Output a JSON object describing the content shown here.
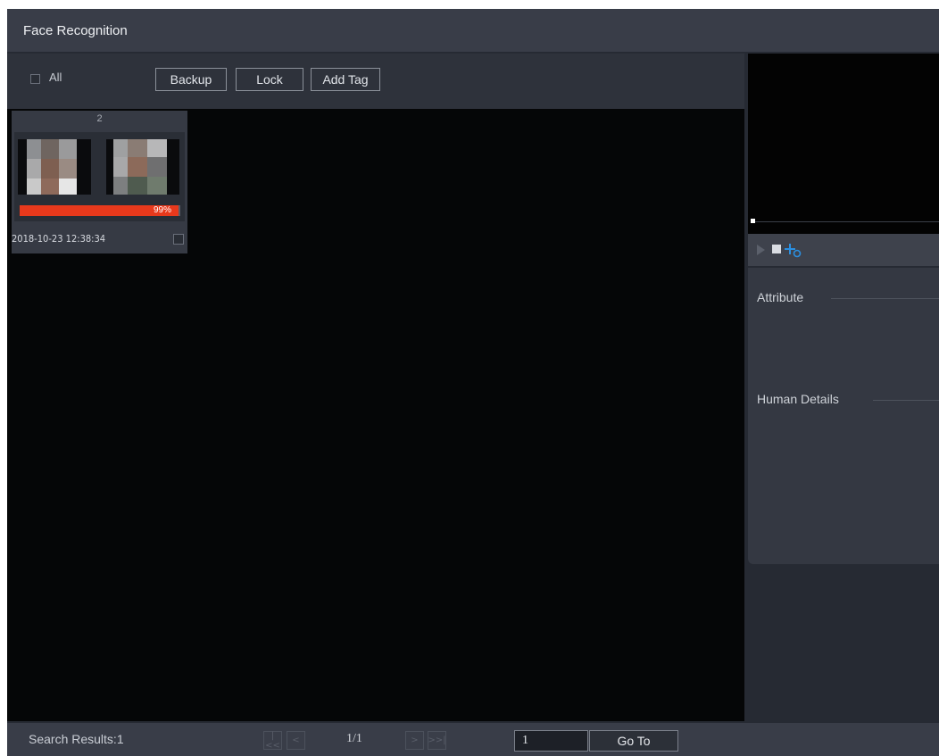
{
  "window": {
    "title": "Face Recognition"
  },
  "toolbar": {
    "all_label": "All",
    "buttons": {
      "backup": "Backup",
      "lock": "Lock",
      "add_tag": "Add Tag"
    }
  },
  "results": {
    "cards": [
      {
        "count": "2",
        "similarity": "99%",
        "similarity_value": 0.99,
        "timestamp": "2018-10-23 12:38:34"
      }
    ]
  },
  "panel": {
    "attribute_label": "Attribute",
    "human_details_label": "Human Details",
    "icons": [
      "play-icon",
      "stop-icon",
      "add-tag-icon"
    ]
  },
  "statusbar": {
    "search_results": "Search Results:1",
    "page_indicator": "1/1",
    "page_input_value": "1",
    "goto_label": "Go To",
    "nav_glyphs": {
      "first": "|<<",
      "prev": "<",
      "next": ">",
      "last": ">>|"
    }
  },
  "colors": {
    "similarity_bar": "#e8391c",
    "background": "#262a33",
    "accent": "#2b8fe0"
  }
}
